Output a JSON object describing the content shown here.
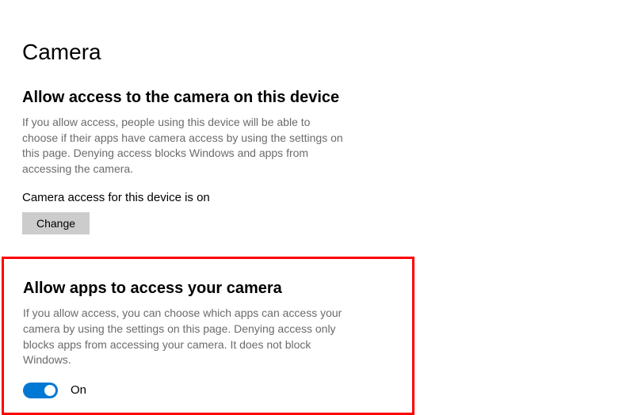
{
  "page_title": "Camera",
  "section1": {
    "heading": "Allow access to the camera on this device",
    "desc": "If you allow access, people using this device will be able to choose if their apps have camera access by using the settings on this page. Denying access blocks Windows and apps from accessing the camera.",
    "status": "Camera access for this device is on",
    "change_label": "Change"
  },
  "section2": {
    "heading": "Allow apps to access your camera",
    "desc": "If you allow access, you can choose which apps can access your camera by using the settings on this page. Denying access only blocks apps from accessing your camera. It does not block Windows.",
    "toggle_value": "On"
  }
}
